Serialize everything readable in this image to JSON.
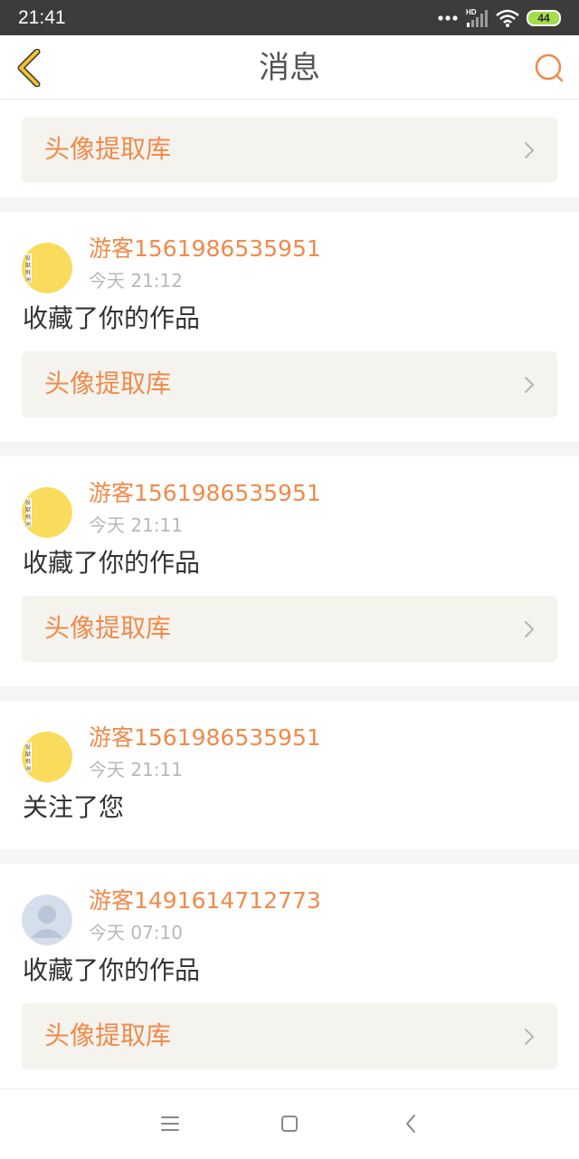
{
  "status_bar": {
    "time": "21:41",
    "battery": "44",
    "signal_label": "HD",
    "icons": [
      "more-dots-icon",
      "signal-icon",
      "wifi-icon",
      "battery-icon"
    ]
  },
  "header": {
    "title": "消息",
    "back_icon": "chevron-left-icon",
    "search_icon": "search-icon"
  },
  "colors": {
    "accent": "#f08a4b",
    "back_icon": "#f2c12e",
    "card_bg": "#f4f3ee",
    "divider": "#f5f5f5",
    "status_bar_bg": "#3c3c3c",
    "battery": "#a3dd4b"
  },
  "top_card": {
    "label": "头像提取库"
  },
  "messages": [
    {
      "username": "游客1561986535951",
      "time": "今天 21:12",
      "content": "收藏了你的作品",
      "avatar": "yellow-stamp-avatar",
      "card_label": "头像提取库"
    },
    {
      "username": "游客1561986535951",
      "time": "今天 21:11",
      "content": "收藏了你的作品",
      "avatar": "yellow-stamp-avatar",
      "card_label": "头像提取库"
    },
    {
      "username": "游客1561986535951",
      "time": "今天 21:11",
      "content": "关注了您",
      "avatar": "yellow-stamp-avatar"
    },
    {
      "username": "游客1491614712773",
      "time": "今天 07:10",
      "content": "收藏了你的作品",
      "avatar": "default-user-avatar",
      "card_label": "头像提取库"
    }
  ],
  "system_nav": {
    "icons": [
      "menu-icon",
      "home-square-icon",
      "back-arrow-icon"
    ]
  }
}
